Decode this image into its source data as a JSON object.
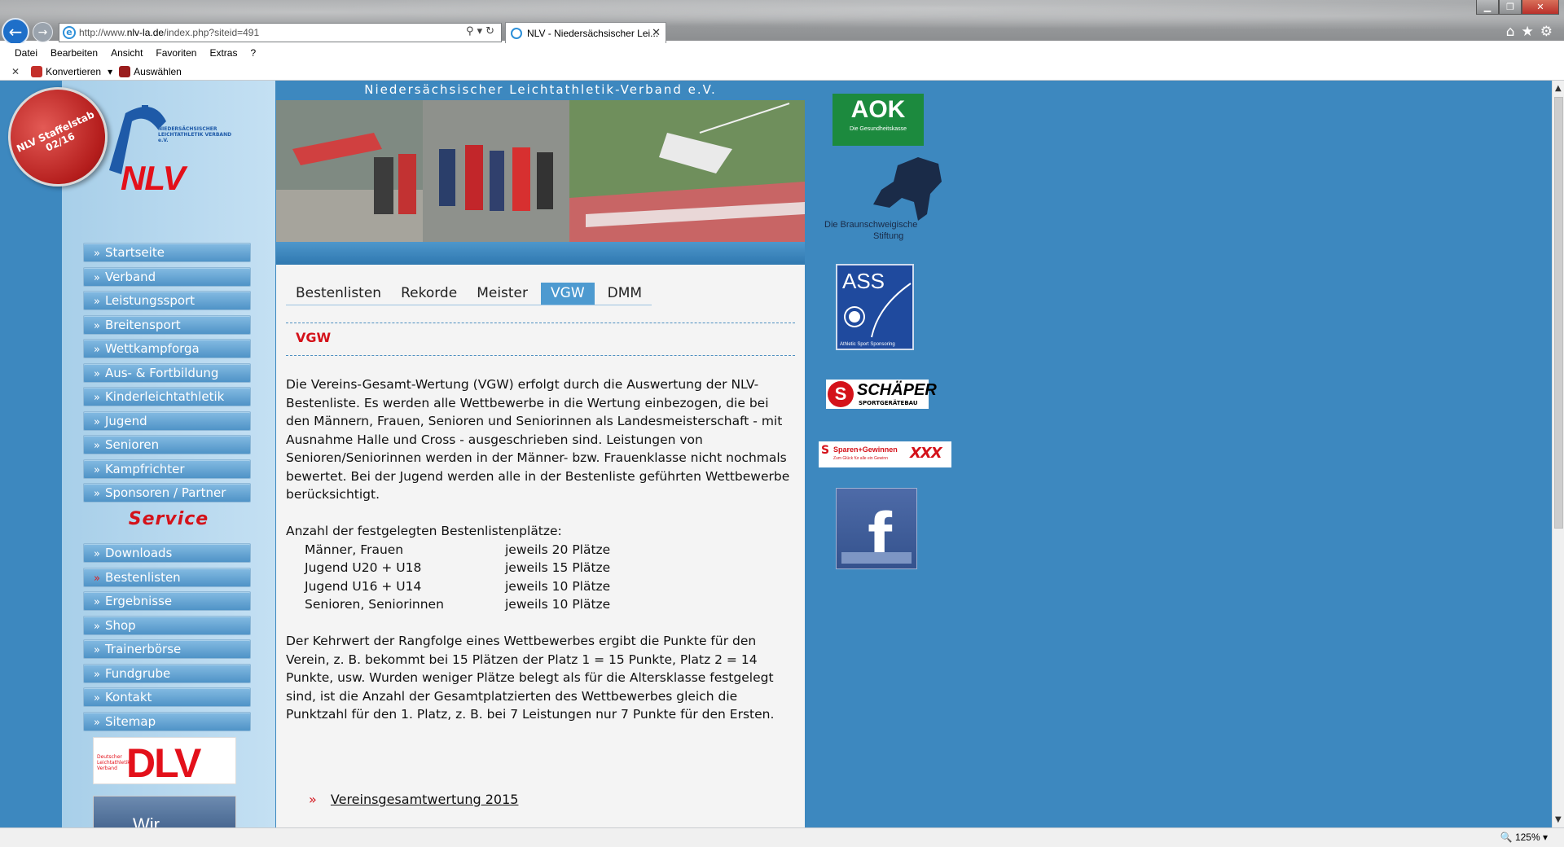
{
  "browser": {
    "address": "http://www.nlv-la.de/index.php?siteid=491",
    "address_prefix": "http://www.",
    "address_host": "nlv-la.de",
    "address_path": "/index.php?siteid=491",
    "tab_title": "NLV - Niedersächsischer Lei...",
    "menu": [
      "Datei",
      "Bearbeiten",
      "Ansicht",
      "Favoriten",
      "Extras",
      "?"
    ],
    "cmd_konvertieren": "Konvertieren",
    "cmd_auswaehlen": "Auswählen",
    "zoom": "125%"
  },
  "logo": {
    "badge": "NLV Staffelstab 02/16",
    "org_small": "NIEDERSÄCHSISCHER LEICHTATHLETIK VERBAND e.V.",
    "org_big": "NLV"
  },
  "nav": {
    "items": [
      {
        "label": "Startseite"
      },
      {
        "label": "Verband"
      },
      {
        "label": "Leistungssport"
      },
      {
        "label": "Breitensport"
      },
      {
        "label": "Wettkampforga"
      },
      {
        "label": "Aus- & Fortbildung"
      },
      {
        "label": "Kinderleichtathletik"
      },
      {
        "label": "Jugend"
      },
      {
        "label": "Senioren"
      },
      {
        "label": "Kampfrichter"
      },
      {
        "label": "Sponsoren / Partner"
      }
    ],
    "arrow": "»",
    "service_heading": "Service",
    "service_items": [
      {
        "label": "Downloads"
      },
      {
        "label": "Bestenlisten"
      },
      {
        "label": "Ergebnisse"
      },
      {
        "label": "Shop"
      },
      {
        "label": "Trainerbörse"
      },
      {
        "label": "Fundgrube"
      },
      {
        "label": "Kontakt"
      },
      {
        "label": "Sitemap"
      }
    ],
    "active_service": "Bestenlisten",
    "dlv_logo": "DLV",
    "dlv_small": "Deutscher Leichtathletik-Verband",
    "wir_text": "Wir"
  },
  "header": {
    "title": "Niedersächsischer Leichtathletik-Verband e.V."
  },
  "tabs": [
    {
      "label": "Bestenlisten",
      "active": false
    },
    {
      "label": "Rekorde",
      "active": false
    },
    {
      "label": "Meister",
      "active": false
    },
    {
      "label": "VGW",
      "active": true
    },
    {
      "label": "DMM",
      "active": false
    }
  ],
  "content": {
    "section_title": "VGW",
    "paragraph1": "Die Vereins-Gesamt-Wertung (VGW) erfolgt durch die Auswertung der NLV-Bestenliste. Es werden alle Wettbewerbe in die Wertung einbezogen, die bei den Männern, Frauen, Senioren und Seniorinnen als Landesmeisterschaft - mit Ausnahme Halle und Cross - ausgeschrieben sind. Leistungen von Senioren/Seniorinnen werden in der Männer- bzw. Frauenklasse nicht nochmals bewertet. Bei der Jugend werden alle in der Bestenliste geführten Wettbewerbe berücksichtigt.",
    "plaetze_heading": "Anzahl der festgelegten Bestenlistenplätze:",
    "plaetze": [
      {
        "klasse": "Männer, Frauen",
        "wert": "jeweils 20 Plätze"
      },
      {
        "klasse": "Jugend U20 + U18",
        "wert": "jeweils 15 Plätze"
      },
      {
        "klasse": "Jugend U16 + U14",
        "wert": "jeweils 10 Plätze"
      },
      {
        "klasse": "Senioren, Seniorinnen",
        "wert": "jeweils 10 Plätze"
      }
    ],
    "paragraph2": "Der Kehrwert der Rangfolge eines Wettbewerbes ergibt die Punkte für den Verein, z. B. bekommt bei 15 Plätzen der Platz 1 = 15 Punkte, Platz 2 = 14 Punkte, usw. Wurden weniger Plätze belegt als für die Altersklasse festgelegt sind, ist die Anzahl der Gesamtplatzierten des Wettbewerbes gleich die Punktzahl für den 1. Platz, z. B. bei 7 Leistungen nur 7 Punkte für den Ersten.",
    "link_arrow": "»",
    "link_label": "Vereinsgesamtwertung 2015"
  },
  "sponsors": {
    "aok": "AOK",
    "aok_sub": "Die Gesundheitskasse",
    "braunschweig_line1": "Die Braunschweigische",
    "braunschweig_line2": "Stiftung",
    "ass": "ASS",
    "ass_sub": "Athletic Sport Sponsoring",
    "schaper": "SCHÄPER",
    "schaper_sub": "SPORTGERÄTEBAU",
    "sparen": "Sparen+Gewinnen",
    "sparen_sub": "Zum Glück für alle ein Gewinn",
    "sparen_xxx": "XXX",
    "facebook": "f"
  },
  "colors": {
    "page_bg": "#3d88bf",
    "left_bg": "#b9d8ee",
    "accent_red": "#d4121a",
    "nav_button": "#5a9dd0"
  }
}
